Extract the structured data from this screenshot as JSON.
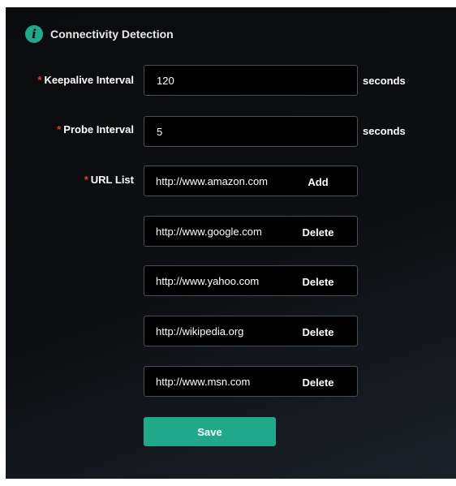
{
  "section": {
    "icon": "info-icon",
    "icon_glyph": "i",
    "title": "Connectivity Detection"
  },
  "required_marker": "*",
  "keepalive": {
    "label": "Keepalive Interval",
    "value": "120",
    "unit": "seconds"
  },
  "probe": {
    "label": "Probe Interval",
    "value": "5",
    "unit": "seconds"
  },
  "url_list": {
    "label": "URL List",
    "new_entry": {
      "value": "http://www.amazon.com",
      "button": "Add"
    },
    "items": [
      {
        "value": "http://www.google.com",
        "button": "Delete"
      },
      {
        "value": "http://www.yahoo.com",
        "button": "Delete"
      },
      {
        "value": "http://wikipedia.org",
        "button": "Delete"
      },
      {
        "value": "http://www.msn.com",
        "button": "Delete"
      }
    ]
  },
  "save_label": "Save",
  "colors": {
    "accent": "#1fa88a",
    "required": "#e0403a",
    "panel_bg": "#0a0b0d"
  }
}
